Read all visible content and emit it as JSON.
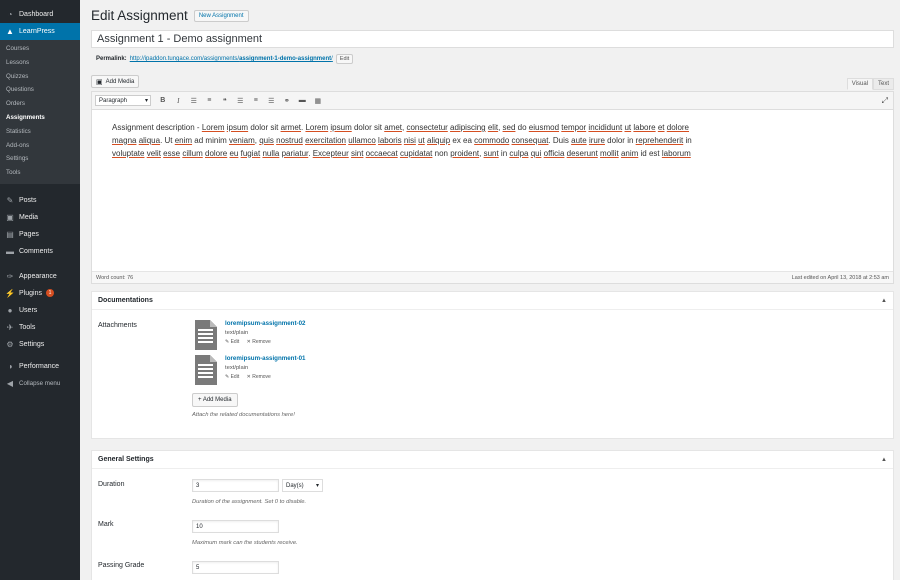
{
  "sidebar": {
    "top_items": [
      {
        "label": "Dashboard",
        "icon": "dashboard-icon",
        "glyph": "◔"
      },
      {
        "label": "LearnPress",
        "icon": "learnpress-icon",
        "glyph": "🎓"
      }
    ],
    "submenu": [
      "Courses",
      "Lessons",
      "Quizzes",
      "Questions",
      "Orders",
      "Assignments",
      "Statistics",
      "Add-ons",
      "Settings",
      "Tools"
    ],
    "current_sub": "Assignments",
    "items": [
      {
        "label": "Posts",
        "icon": "posts-icon",
        "glyph": "✎"
      },
      {
        "label": "Media",
        "icon": "media-icon",
        "glyph": "▣"
      },
      {
        "label": "Pages",
        "icon": "pages-icon",
        "glyph": "▤"
      },
      {
        "label": "Comments",
        "icon": "comments-icon",
        "glyph": "▬"
      },
      {
        "label": "Appearance",
        "icon": "appearance-icon",
        "glyph": "✑"
      },
      {
        "label": "Plugins",
        "icon": "plugins-icon",
        "glyph": "⚡",
        "badge": "1"
      },
      {
        "label": "Users",
        "icon": "users-icon",
        "glyph": "●"
      },
      {
        "label": "Tools",
        "icon": "tools-icon",
        "glyph": "✈"
      },
      {
        "label": "Settings",
        "icon": "settings-icon",
        "glyph": "⚙"
      },
      {
        "label": "Performance",
        "icon": "performance-icon",
        "glyph": "◑"
      },
      {
        "label": "Collapse menu",
        "icon": "collapse-icon",
        "glyph": "◀"
      }
    ]
  },
  "header": {
    "title": "Edit Assignment",
    "new_button": "New Assignment"
  },
  "post": {
    "title": "Assignment 1 - Demo assignment",
    "permalink_label": "Permalink:",
    "permalink_base": "http://ipaddon.tungace.com/assignments/",
    "permalink_slug": "assignment-1-demo-assignment",
    "permalink_end": "/",
    "edit_button": "Edit"
  },
  "editor": {
    "add_media": "Add Media",
    "tabs": [
      "Visual",
      "Text"
    ],
    "format": "Paragraph",
    "content_parts": [
      [
        "Assignment description - ",
        false
      ],
      [
        "Lorem",
        true
      ],
      [
        " ",
        false
      ],
      [
        "ipsum",
        true
      ],
      [
        " dolor sit ",
        false
      ],
      [
        "armet",
        true
      ],
      [
        ". ",
        false
      ],
      [
        "Lorem",
        true
      ],
      [
        " ",
        false
      ],
      [
        "ipsum",
        true
      ],
      [
        " dolor sit ",
        false
      ],
      [
        "amet",
        true
      ],
      [
        ", ",
        false
      ],
      [
        "consectetur",
        true
      ],
      [
        " ",
        false
      ],
      [
        "adipiscing",
        true
      ],
      [
        " ",
        false
      ],
      [
        "elit",
        true
      ],
      [
        ", ",
        false
      ],
      [
        "sed",
        true
      ],
      [
        " do ",
        false
      ],
      [
        "eiusmod",
        true
      ],
      [
        " ",
        false
      ],
      [
        "tempor",
        true
      ],
      [
        " ",
        false
      ],
      [
        "incididunt",
        true
      ],
      [
        " ",
        false
      ],
      [
        "ut",
        true
      ],
      [
        " ",
        false
      ],
      [
        "labore",
        true
      ],
      [
        " ",
        false
      ],
      [
        "et",
        true
      ],
      [
        " ",
        false
      ],
      [
        "dolore",
        true
      ],
      [
        " ",
        false
      ],
      [
        "magna",
        true
      ],
      [
        " ",
        false
      ],
      [
        "aliqua",
        true
      ],
      [
        ". Ut ",
        false
      ],
      [
        "enim",
        true
      ],
      [
        " ad minim ",
        false
      ],
      [
        "veniam",
        true
      ],
      [
        ", ",
        false
      ],
      [
        "quis",
        true
      ],
      [
        " ",
        false
      ],
      [
        "nostrud",
        true
      ],
      [
        " ",
        false
      ],
      [
        "exercitation",
        true
      ],
      [
        " ",
        false
      ],
      [
        "ullamco",
        true
      ],
      [
        " ",
        false
      ],
      [
        "laboris",
        true
      ],
      [
        " ",
        false
      ],
      [
        "nisi",
        true
      ],
      [
        " ",
        false
      ],
      [
        "ut",
        true
      ],
      [
        " ",
        false
      ],
      [
        "aliquip",
        true
      ],
      [
        " ex ea ",
        false
      ],
      [
        "commodo",
        true
      ],
      [
        " ",
        false
      ],
      [
        "consequat",
        true
      ],
      [
        ". Duis ",
        false
      ],
      [
        "aute",
        true
      ],
      [
        " ",
        false
      ],
      [
        "irure",
        true
      ],
      [
        " dolor in ",
        false
      ],
      [
        "reprehenderit",
        true
      ],
      [
        " in ",
        false
      ],
      [
        "voluptate",
        true
      ],
      [
        " ",
        false
      ],
      [
        "velit",
        true
      ],
      [
        " ",
        false
      ],
      [
        "esse",
        true
      ],
      [
        " ",
        false
      ],
      [
        "cillum",
        true
      ],
      [
        " ",
        false
      ],
      [
        "dolore",
        true
      ],
      [
        " ",
        false
      ],
      [
        "eu",
        true
      ],
      [
        " ",
        false
      ],
      [
        "fugiat",
        true
      ],
      [
        " ",
        false
      ],
      [
        "nulla",
        true
      ],
      [
        " ",
        false
      ],
      [
        "pariatur",
        true
      ],
      [
        ". ",
        false
      ],
      [
        "Excepteur",
        true
      ],
      [
        " ",
        false
      ],
      [
        "sint",
        true
      ],
      [
        " ",
        false
      ],
      [
        "occaecat",
        true
      ],
      [
        " ",
        false
      ],
      [
        "cupidatat",
        true
      ],
      [
        " non ",
        false
      ],
      [
        "proident",
        true
      ],
      [
        ", ",
        false
      ],
      [
        "sunt",
        true
      ],
      [
        " in ",
        false
      ],
      [
        "culpa",
        true
      ],
      [
        " ",
        false
      ],
      [
        "qui",
        true
      ],
      [
        " ",
        false
      ],
      [
        "officia",
        true
      ],
      [
        " ",
        false
      ],
      [
        "deserunt",
        true
      ],
      [
        " ",
        false
      ],
      [
        "mollit",
        true
      ],
      [
        " ",
        false
      ],
      [
        "anim",
        true
      ],
      [
        " id est ",
        false
      ],
      [
        "laborum",
        true
      ]
    ],
    "word_count": "Word count: 76",
    "last_edited": "Last edited on April 13, 2018 at 2:53 am"
  },
  "documentations": {
    "title": "Documentations",
    "label": "Attachments",
    "files": [
      {
        "name": "loremipsum-assignment-02",
        "type": "text/plain",
        "edit": "Edit",
        "remove": "Remove"
      },
      {
        "name": "loremipsum-assignment-01",
        "type": "text/plain",
        "edit": "Edit",
        "remove": "Remove"
      }
    ],
    "add_button": "+ Add Media",
    "hint": "Attach the related documentations here!"
  },
  "general": {
    "title": "General Settings",
    "duration_label": "Duration",
    "duration_value": "3",
    "duration_unit": "Day(s)",
    "duration_desc": "Duration of the assignment. Set 0 to disable.",
    "mark_label": "Mark",
    "mark_value": "10",
    "mark_desc": "Maximum mark can the students receive.",
    "passing_label": "Passing Grade",
    "passing_value": "5"
  },
  "colors": {
    "sidebar_bg": "#23282d",
    "accent": "#0073aa",
    "spell_underline": "#d54e21"
  }
}
